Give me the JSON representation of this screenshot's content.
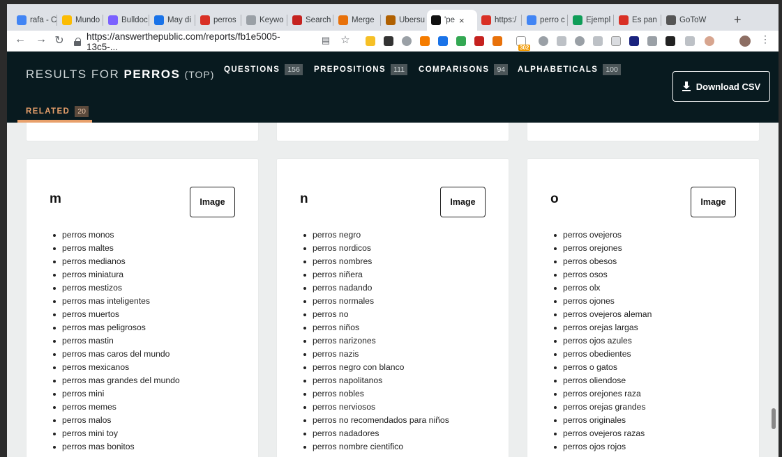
{
  "browser": {
    "tabs": [
      {
        "label": "rafa - C",
        "icon": "ads-icon",
        "color": "#4285f4"
      },
      {
        "label": "Mundo",
        "icon": "ads-icon",
        "color": "#fbbc04"
      },
      {
        "label": "Bulldoc",
        "icon": "chart-icon",
        "color": "#7b61ff"
      },
      {
        "label": "May di",
        "icon": "pointer-icon",
        "color": "#1a73e8"
      },
      {
        "label": "perros",
        "icon": "pin-icon",
        "color": "#d93025"
      },
      {
        "label": "Keywo",
        "icon": "page-icon",
        "color": "#9aa0a6"
      },
      {
        "label": "Search",
        "icon": "flame-icon",
        "color": "#c5221f"
      },
      {
        "label": "Merge",
        "icon": "diamond-icon",
        "color": "#e8710a"
      },
      {
        "label": "Ubersu",
        "icon": "face-icon",
        "color": "#b06000"
      },
      {
        "label": "'pe",
        "icon": "bubble-icon",
        "color": "#111111"
      },
      {
        "label": "https:/",
        "icon": "circle-icon",
        "color": "#d93025"
      },
      {
        "label": "perro c",
        "icon": "google-icon",
        "color": "#4285f4"
      },
      {
        "label": "Ejempl",
        "icon": "sheets-icon",
        "color": "#0f9d58"
      },
      {
        "label": "Es pan",
        "icon": "gmail-icon",
        "color": "#d93025"
      },
      {
        "label": "GoToW",
        "icon": "gotowebinar-icon",
        "color": "#555555"
      }
    ],
    "url": "https://answerthepublic.com/reports/fb1e5005-13c5-...",
    "extension_badge": "302"
  },
  "header": {
    "results_prefix": "RESULTS FOR",
    "keyword": "PERROS",
    "mode": "(TOP)",
    "tabs": [
      {
        "label": "QUESTIONS",
        "count": "156"
      },
      {
        "label": "PREPOSITIONS",
        "count": "111"
      },
      {
        "label": "COMPARISONS",
        "count": "94"
      },
      {
        "label": "ALPHABETICALS",
        "count": "100"
      }
    ],
    "related": {
      "label": "RELATED",
      "count": "20"
    },
    "download_label": "Download CSV",
    "accent_color": "#e8a06b",
    "background_color": "#081a1f"
  },
  "cards": [
    {
      "letter": "m",
      "image_label": "Image",
      "items": [
        "perros monos",
        "perros maltes",
        "perros medianos",
        "perros miniatura",
        "perros mestizos",
        "perros mas inteligentes",
        "perros muertos",
        "perros mas peligrosos",
        "perros mastin",
        "perros mas caros del mundo",
        "perros mexicanos",
        "perros mas grandes del mundo",
        "perros mini",
        "perros memes",
        "perros malos",
        "perros mini toy",
        "perros mas bonitos"
      ]
    },
    {
      "letter": "n",
      "image_label": "Image",
      "items": [
        "perros negro",
        "perros nordicos",
        "perros nombres",
        "perros niñera",
        "perros nadando",
        "perros normales",
        "perros no",
        "perros niños",
        "perros narizones",
        "perros nazis",
        "perros negro con blanco",
        "perros napolitanos",
        "perros nobles",
        "perros nerviosos",
        "perros no recomendados para niños",
        "perros nadadores",
        "perros nombre cientifico"
      ]
    },
    {
      "letter": "o",
      "image_label": "Image",
      "items": [
        "perros ovejeros",
        "perros orejones",
        "perros obesos",
        "perros osos",
        "perros olx",
        "perros ojones",
        "perros ovejeros aleman",
        "perros orejas largas",
        "perros ojos azules",
        "perros obedientes",
        "perros o gatos",
        "perros oliendose",
        "perros orejones raza",
        "perros orejas grandes",
        "perros originales",
        "perros ovejeros razas",
        "perros ojos rojos"
      ]
    }
  ]
}
